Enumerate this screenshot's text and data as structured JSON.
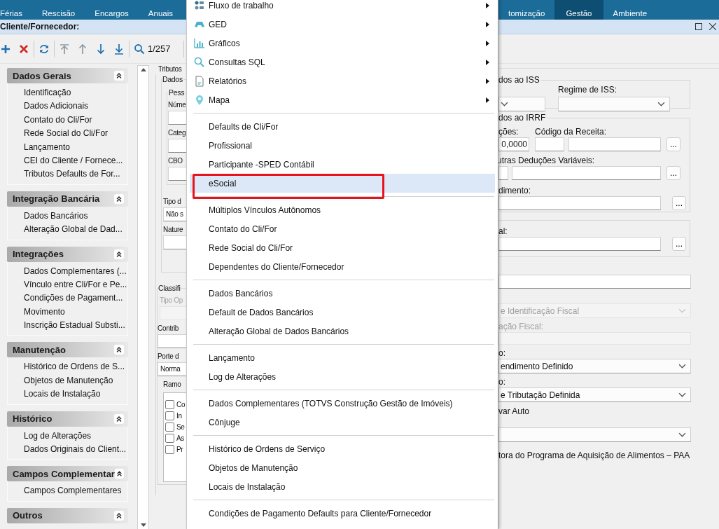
{
  "top_tabs": {
    "before_menu": [
      {
        "label": "Férias",
        "selected": false
      },
      {
        "label": "Rescisão",
        "selected": false
      },
      {
        "label": "Encargos",
        "selected": false
      },
      {
        "label": "Anuais",
        "selected": false
      }
    ],
    "after_menu": [
      {
        "label": "tomização",
        "selected": false
      },
      {
        "label": "Gestão",
        "selected": true
      },
      {
        "label": "Ambiente",
        "selected": false
      }
    ]
  },
  "window": {
    "title": "Cliente/Fornecedor:"
  },
  "toolbar": {
    "record_counter": "1/257"
  },
  "sidebar": {
    "sections": [
      {
        "title": "Dados Gerais",
        "expanded": true,
        "items": [
          "Identificação",
          "Dados Adicionais",
          "Contato do Cli/For",
          "Rede Social do Cli/For",
          "Lançamento",
          "CEI do Cliente / Fornece...",
          "Tributos Defaults de For..."
        ]
      },
      {
        "title": "Integração Bancária",
        "expanded": true,
        "items": [
          "Dados Bancários",
          "Alteração Global de Dad..."
        ]
      },
      {
        "title": "Integrações",
        "expanded": true,
        "items": [
          "Dados Complementares (...",
          "Vínculo entre Cli/For e Pe...",
          "Condições de Pagament...",
          "Movimento",
          "Inscrição Estadual Substi..."
        ]
      },
      {
        "title": "Manutenção",
        "expanded": true,
        "items": [
          "Histórico de Ordens de S...",
          "Objetos de Manutenção",
          "Locais de Instalação"
        ]
      },
      {
        "title": "Histórico",
        "expanded": true,
        "items": [
          "Log de Alterações",
          "Dados Originais do Client..."
        ]
      },
      {
        "title": "Campos Complementar",
        "expanded": true,
        "items": [
          "Campos Complementares"
        ]
      },
      {
        "title": "Outros",
        "expanded": true
      }
    ]
  },
  "left_form": {
    "tab_label": "Tributos",
    "data_group": "Dados",
    "person_group": "Pess",
    "number_label": "Núme",
    "category_label": "Categ",
    "cbo_label": "CBO",
    "type_label": "Tipo d",
    "type_value": "Não s",
    "nature_label": "Nature",
    "classification_group": "Classifi",
    "operation_label": {
      "text": "Tipo Op",
      "disabled": true
    },
    "contributor_label": "Contrib",
    "size_label": "Porte d",
    "size_value": "Norma",
    "branch_label": "Ramo",
    "branches": [
      {
        "text": "Co",
        "checked": false
      },
      {
        "text": "In",
        "checked": false
      },
      {
        "text": "Se",
        "checked": false
      },
      {
        "text": "As",
        "checked": false
      },
      {
        "text": "Pr",
        "checked": false
      }
    ]
  },
  "menu": {
    "groups": [
      [
        {
          "label": "Fluxo de trabalho",
          "submenu": true,
          "selected": false,
          "boxed": false
        },
        {
          "label": "GED",
          "submenu": true,
          "selected": false,
          "boxed": false
        },
        {
          "label": "Gráficos",
          "submenu": true,
          "selected": false,
          "boxed": false
        },
        {
          "label": "Consultas SQL",
          "submenu": true,
          "selected": false,
          "boxed": false
        },
        {
          "label": "Relatórios",
          "submenu": true,
          "selected": false,
          "boxed": false
        },
        {
          "label": "Mapa",
          "submenu": true,
          "selected": false,
          "boxed": false
        }
      ],
      [
        {
          "label": "Defaults de Cli/For",
          "submenu": false,
          "selected": false,
          "boxed": false
        },
        {
          "label": "Profissional",
          "submenu": false,
          "selected": false,
          "boxed": false
        },
        {
          "label": "Participante -SPED Contábil",
          "submenu": false,
          "selected": false,
          "boxed": false
        },
        {
          "label": "eSocial",
          "submenu": false,
          "selected": true,
          "boxed": true
        }
      ],
      [
        {
          "label": "Múltiplos Vínculos Autônomos",
          "submenu": false,
          "selected": false,
          "boxed": false
        },
        {
          "label": "Contato do Cli/For",
          "submenu": false,
          "selected": false,
          "boxed": false
        },
        {
          "label": "Rede Social do Cli/For",
          "submenu": false,
          "selected": false,
          "boxed": false
        },
        {
          "label": "Dependentes do Cliente/Fornecedor",
          "submenu": false,
          "selected": false,
          "boxed": false
        }
      ],
      [
        {
          "label": "Dados Bancários",
          "submenu": false,
          "selected": false,
          "boxed": false
        },
        {
          "label": "Default de Dados Bancários",
          "submenu": false,
          "selected": false,
          "boxed": false
        },
        {
          "label": "Alteração Global de Dados Bancários",
          "submenu": false,
          "selected": false,
          "boxed": false
        }
      ],
      [
        {
          "label": "Lançamento",
          "submenu": false,
          "selected": false,
          "boxed": false
        },
        {
          "label": "Log de Alterações",
          "submenu": false,
          "selected": false,
          "boxed": false
        }
      ],
      [
        {
          "label": "Dados Complementares (TOTVS Construção Gestão de Imóveis)",
          "submenu": false,
          "selected": false,
          "boxed": false
        },
        {
          "label": "Cônjuge",
          "submenu": false,
          "selected": false,
          "boxed": false
        }
      ],
      [
        {
          "label": "Histórico de Ordens de Serviço",
          "submenu": false,
          "selected": false,
          "boxed": false
        },
        {
          "label": "Objetos de Manutenção",
          "submenu": false,
          "selected": false,
          "boxed": false
        },
        {
          "label": "Locais de Instalação",
          "submenu": false,
          "selected": false,
          "boxed": false
        }
      ],
      [
        {
          "label": "Condições de Pagamento Defaults para Cliente/Fornecedor",
          "submenu": false,
          "selected": false,
          "boxed": false
        }
      ]
    ]
  },
  "right_form": {
    "iss": {
      "title": "dos ao ISS",
      "regime_label": "Regime de ISS:"
    },
    "irrf": {
      "title": "dos ao IRRF",
      "deductions_label": "ções:",
      "revenue_code_label": "Código da Receita:",
      "deductions_value": "0,0000",
      "revenue_button": "...",
      "other_label": "utras Deduções Variáveis:",
      "other_button": "...",
      "income_label": "dimento:",
      "income_button": "..."
    },
    "extra_group": {
      "label": "al:",
      "button": "..."
    },
    "fiscal_id_select": {
      "value": "e Identificação Fiscal",
      "disabled": true
    },
    "fiscal_label": {
      "text": "ação Fiscal:",
      "disabled": true
    },
    "income_select_label": "o:",
    "income_select": "endimento Definido",
    "taxation_select_label": "o:",
    "taxation_select": "e Tributação Definida",
    "auto_label": "var Auto",
    "paa_label": "tora do Programa de Aquisição de Alimentos – PAA"
  }
}
